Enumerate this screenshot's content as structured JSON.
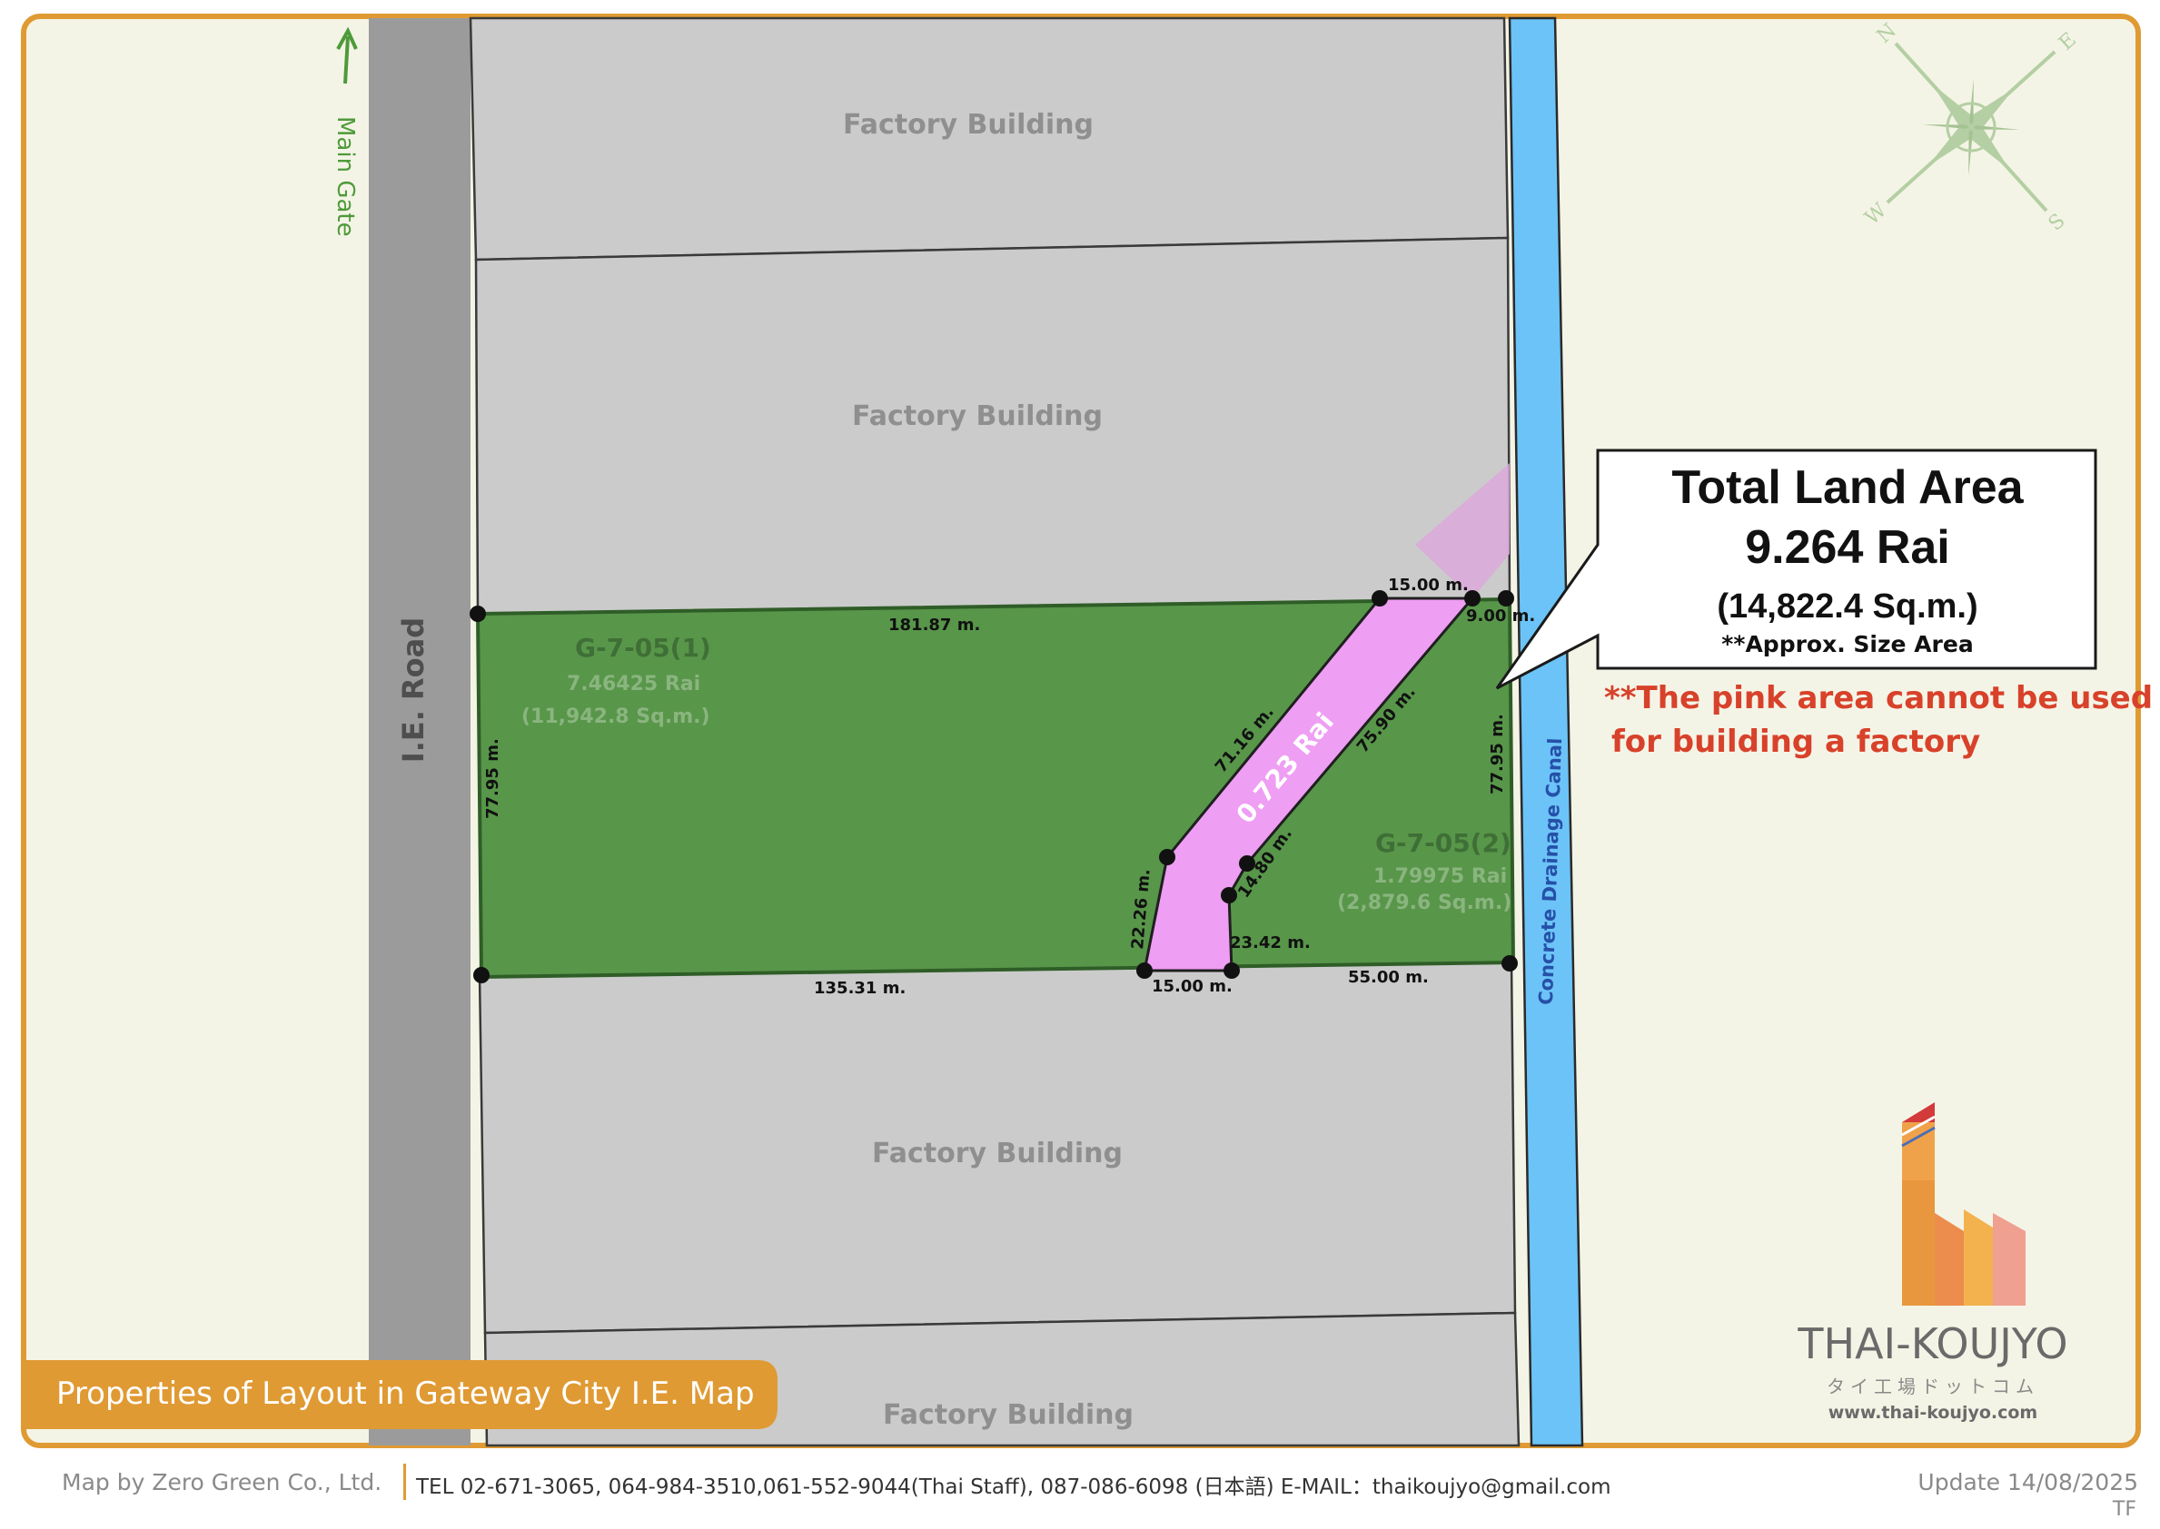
{
  "map": {
    "road_label": "I.E. Road",
    "main_gate_label": "Main Gate",
    "canal_label": "Concrete Drainage Canal",
    "factory_label": "Factory Building",
    "plot1": {
      "name": "G-7-05(1)",
      "rai": "7.46425 Rai",
      "sqm": "(11,942.8 Sq.m.)"
    },
    "plot2": {
      "name": "G-7-05(2)",
      "rai": "1.79975 Rai",
      "sqm": "(2,879.6 Sq.m.)"
    },
    "pink_area": "0.723 Rai",
    "dimensions": {
      "top": "181.87 m.",
      "top_pink": "15.00 m.",
      "top_right": "9.00 m.",
      "left": "77.95 m.",
      "right": "77.95 m.",
      "diag_left": "71.16 m.",
      "diag_right": "75.90 m.",
      "short_diag": "14.80 m.",
      "lower_left": "22.26 m.",
      "lower_right": "23.42 m.",
      "bottom_left": "135.31 m.",
      "bottom_pink": "15.00 m.",
      "bottom_right": "55.00 m."
    },
    "compass": {
      "n": "N",
      "e": "E",
      "s": "S",
      "w": "W"
    },
    "colors": {
      "plot": "#58964a",
      "pink": "#ee9ef3",
      "canal": "#6cc3f7",
      "road": "#9b9b9b",
      "factory": "#cbcbcb",
      "frame": "#e09a33",
      "land": "#f4f4e6"
    }
  },
  "callout": {
    "title": "Total Land Area",
    "rai": "9.264 Rai",
    "sqm": "(14,822.4 Sq.m.)",
    "note": "**Approx. Size Area"
  },
  "warning": {
    "line1": "**The pink area cannot be used",
    "line2": "for building a factory"
  },
  "banner": "Properties of Layout in Gateway City I.E. Map",
  "logo": {
    "brand": "THAI-KOUJYO",
    "kana": "タイ工場ドットコム",
    "url": "www.thai-koujyo.com"
  },
  "footer": {
    "map_by": "Map by Zero Green Co., Ltd.",
    "contact": "TEL 02-671-3065, 064-984-3510,061-552-9044(Thai Staff), 087-086-6098 (日本語) E-MAIL：thaikoujyo@gmail.com",
    "update": "Update 14/08/2025",
    "code": "TF"
  }
}
